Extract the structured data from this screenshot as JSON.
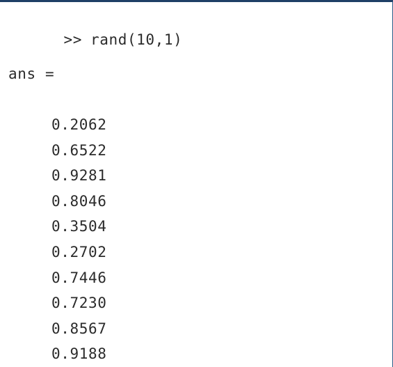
{
  "console": {
    "prompt": ">>",
    "command": "rand(10,1)",
    "answer_label": "ans =",
    "values": [
      "0.2062",
      "0.6522",
      "0.9281",
      "0.8046",
      "0.3504",
      "0.2702",
      "0.7446",
      "0.7230",
      "0.8567",
      "0.9188"
    ]
  }
}
